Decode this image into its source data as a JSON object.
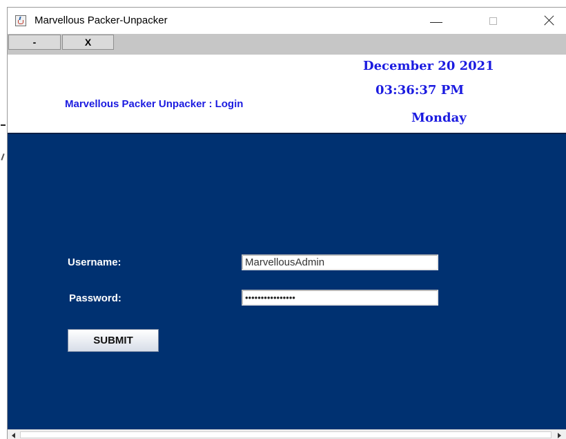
{
  "window": {
    "title": "Marvellous Packer-Unpacker",
    "icon": "java-cup-icon",
    "controls": {
      "minimize": "minimize-icon",
      "maximize": "maximize-icon",
      "close": "close-icon"
    }
  },
  "toolbar": {
    "minimize_label": "-",
    "close_label": "X"
  },
  "header": {
    "title": "Marvellous Packer Unpacker : Login",
    "date": "December 20 2021",
    "time": "03:36:37 PM",
    "day": "Monday"
  },
  "form": {
    "username_label": "Username:",
    "username_value": "MarvellousAdmin",
    "password_label": "Password:",
    "password_value": "••••••••••••••••",
    "submit_label": "SUBMIT"
  },
  "colors": {
    "panel_bg": "#003171",
    "header_text": "#1b1be0",
    "toolbar_bg": "#c6c6c6"
  }
}
